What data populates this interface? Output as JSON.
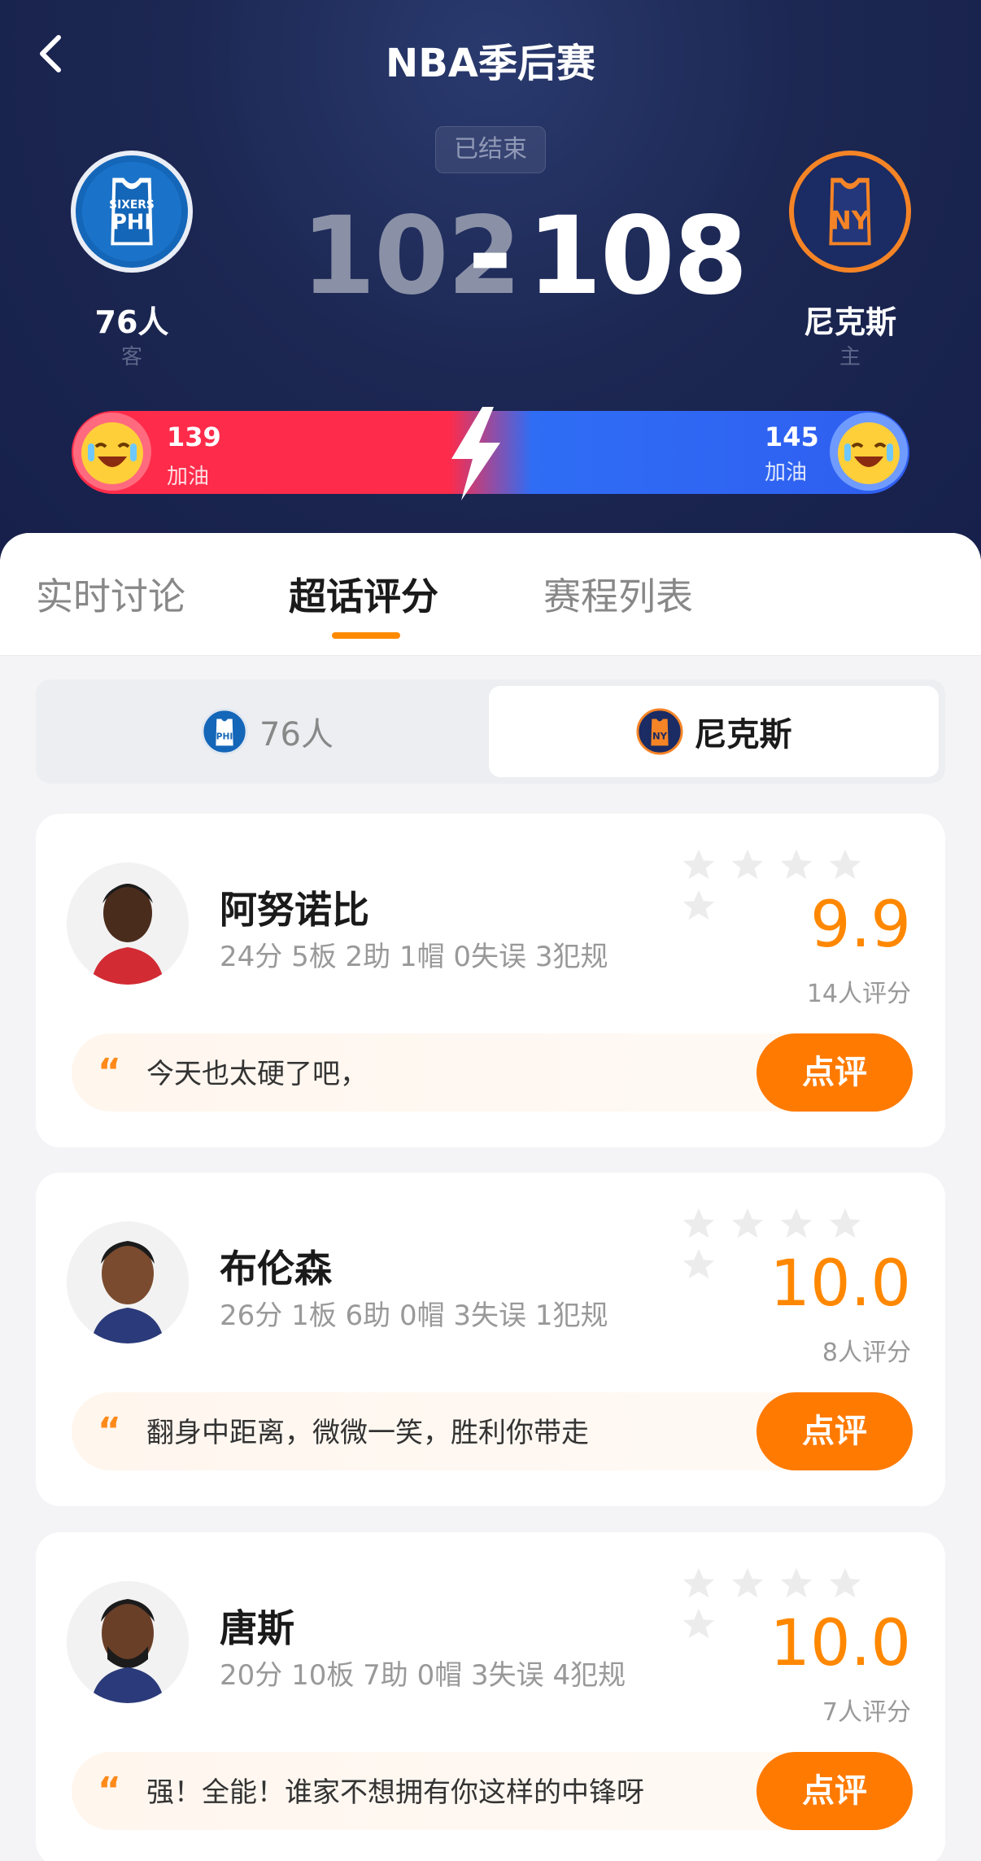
{
  "header": {
    "title": "NBA季后赛",
    "status": "已结束",
    "home": {
      "name": "76人",
      "tag": "客",
      "score": "102",
      "cheers": "139",
      "cheer_label": "加油",
      "logo_text": "PHI",
      "logo_top": "SIXERS"
    },
    "away": {
      "name": "尼克斯",
      "tag": "主",
      "score": "108",
      "cheers": "145",
      "cheer_label": "加油",
      "logo_text": "NY"
    },
    "dash": "-"
  },
  "tabs": [
    {
      "label": "实时讨论"
    },
    {
      "label": "超话评分"
    },
    {
      "label": "赛程列表"
    }
  ],
  "segment": {
    "left": "76人",
    "right": "尼克斯"
  },
  "players": [
    {
      "name": "阿努诺比",
      "stats": "24分 5板 2助 1帽 0失误 3犯规",
      "rating": "9.9",
      "count": "14人评分",
      "comment": "今天也太硬了吧，",
      "button": "点评"
    },
    {
      "name": "布伦森",
      "stats": "26分 1板 6助 0帽 3失误 1犯规",
      "rating": "10.0",
      "count": "8人评分",
      "comment": "翻身中距离，微微一笑，胜利你带走",
      "button": "点评"
    },
    {
      "name": "唐斯",
      "stats": "20分 10板 7助 0帽 3失误 4犯规",
      "rating": "10.0",
      "count": "7人评分",
      "comment": "强！全能！谁家不想拥有你这样的中锋呀",
      "button": "点评"
    }
  ],
  "colors": {
    "accent": "#ff7a00",
    "home_red": "#ff2b4a",
    "away_blue": "#2f5ef0",
    "header_bg": "#1c2752"
  }
}
